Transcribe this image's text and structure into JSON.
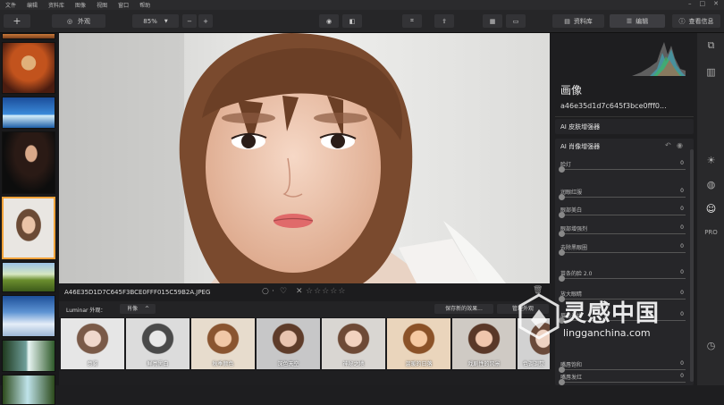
{
  "menu": [
    "文件",
    "编辑",
    "资料库",
    "图像",
    "视图",
    "窗口",
    "帮助"
  ],
  "toolbar": {
    "add": "+",
    "looks_label": "外观",
    "zoom": "85%",
    "zoom_minus": "−",
    "zoom_plus": "+",
    "library_tab": "资料库",
    "edit_tab": "编辑",
    "info_tab": "查看信息"
  },
  "file_name": "A46E35D1D7C645F3BCE0FFF015C59B2A.JPEG",
  "looks_bar": {
    "label": "Luminar 外观：",
    "category": "肖像",
    "save_look": "保存新的效果...",
    "manage": "管理外观"
  },
  "looks": [
    "意雾",
    "鲜亮黑白",
    "秋季颜色",
    "深色天空",
    "神秘之地",
    "温暖的日落",
    "戏剧性的风景",
    "色调调整"
  ],
  "panel": {
    "title": "画像",
    "image_name": "a46e35d1d7c645f3bce0fff0...",
    "skin_enhancer": "AI 皮肤增强器",
    "portrait_enhancer": "AI 肖像增强器",
    "sliders": [
      {
        "label": "脸灯",
        "value": "0"
      },
      {
        "label": "润眼红服",
        "value": "0"
      },
      {
        "label": "眼部美白",
        "value": "0"
      },
      {
        "label": "眼部增强剂",
        "value": "0"
      },
      {
        "label": "去除黑眼圈",
        "value": "0"
      },
      {
        "label": "苗条的脸 2.0",
        "value": "0"
      },
      {
        "label": "放大眼睛",
        "value": "0"
      },
      {
        "label": "眉毛光线",
        "value": "0"
      },
      {
        "label": "嘴唇饱和",
        "value": "0"
      },
      {
        "label": "嘴唇发红",
        "value": "0"
      }
    ]
  },
  "watermark": {
    "cn": "灵感中国",
    "url": "lingganchina.com"
  },
  "colors": {
    "accent": "#f2a33a",
    "panel": "#1e1e20"
  }
}
